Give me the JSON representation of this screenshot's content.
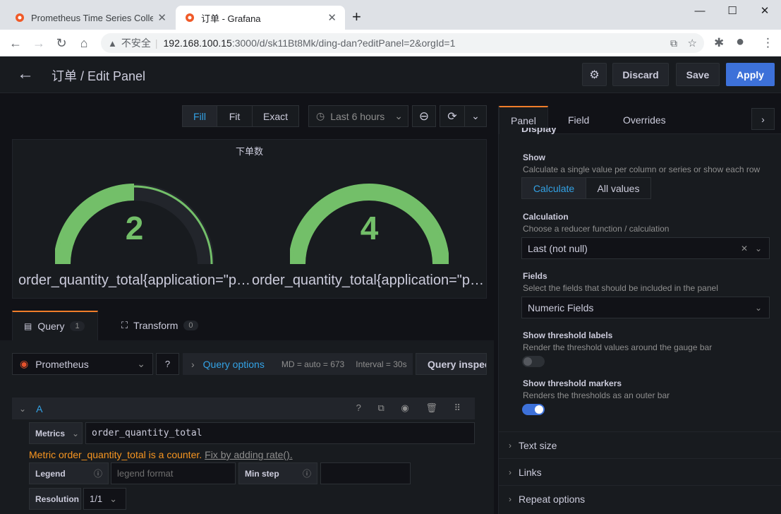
{
  "browser": {
    "tabs": [
      {
        "title": "Prometheus Time Series Collec",
        "active": false
      },
      {
        "title": "订单 - Grafana",
        "active": true
      }
    ],
    "close_glyph": "✕",
    "new_tab_glyph": "+",
    "window_controls": {
      "minimize": "—",
      "maximize": "☐",
      "close": "✕"
    },
    "nav": {
      "back": "←",
      "forward": "→",
      "reload": "↻",
      "home": "⌂"
    },
    "address": {
      "warning_icon": "▲",
      "security_label": "不安全",
      "separator": "|",
      "host": "192.168.100.15",
      "path": ":3000/d/sk11Bt8Mk/ding-dan?editPanel=2&orgId=1",
      "translate_icon": "⧉",
      "star_icon": "☆"
    },
    "extensions": {
      "puzzle": "✱",
      "profile": "●",
      "menu": "⋮"
    }
  },
  "header": {
    "back_glyph": "←",
    "title": "订单 / Edit Panel",
    "settings_glyph": "⚙",
    "discard": "Discard",
    "save": "Save",
    "apply": "Apply"
  },
  "toolbar": {
    "fill": "Fill",
    "fit": "Fit",
    "exact": "Exact",
    "time_range": "Last 6 hours",
    "clock_glyph": "◷",
    "chev_glyph": "⌄",
    "zoom_glyph": "⊖",
    "refresh_glyph": "⟳"
  },
  "panel": {
    "title": "下单数",
    "gauges": [
      {
        "value": "2",
        "fraction": 0.5,
        "label": "order_quantity_total{application=\"p…"
      },
      {
        "value": "4",
        "fraction": 1.0,
        "label": "order_quantity_total{application=\"p…"
      }
    ],
    "colors": {
      "fill": "#73bf69",
      "track": "#22252b"
    }
  },
  "query_tabs": {
    "query": {
      "label": "Query",
      "count": "1",
      "icon": "▤"
    },
    "transform": {
      "label": "Transform",
      "count": "0",
      "icon": "⛶"
    }
  },
  "query_bar": {
    "datasource": "Prometheus",
    "ds_icon": "◉",
    "help_glyph": "?",
    "options_chevron": "›",
    "options_label": "Query options",
    "md": "MD = auto = 673",
    "interval": "Interval = 30s",
    "inspector": "Query inspector"
  },
  "query_a": {
    "name": "A",
    "chevron": "⌄",
    "icons": "? ⧉ ◉ 🗑 ⠿",
    "metrics_label": "Metrics",
    "metrics_value": "order_quantity_total",
    "warning_text": "Metric order_quantity_total is a counter.",
    "warning_link": "Fix by adding rate().",
    "legend_label": "Legend",
    "legend_placeholder": "legend format",
    "minstep_label": "Min step",
    "info_glyph": "ⓘ",
    "resolution_label": "Resolution",
    "resolution_value": "1/1"
  },
  "options_pane": {
    "tabs": {
      "panel": "Panel",
      "field": "Field",
      "overrides": "Overrides"
    },
    "arrow_glyph": "›",
    "section_partial": "Display",
    "show": {
      "title": "Show",
      "desc": "Calculate a single value per column or series or show each row",
      "calculate": "Calculate",
      "all_values": "All values"
    },
    "calculation": {
      "title": "Calculation",
      "desc": "Choose a reducer function / calculation",
      "value": "Last (not null)",
      "clear_glyph": "✕",
      "chev_glyph": "⌄"
    },
    "fields": {
      "title": "Fields",
      "desc": "Select the fields that should be included in the panel",
      "value": "Numeric Fields"
    },
    "threshold_labels": {
      "title": "Show threshold labels",
      "desc": "Render the threshold values around the gauge bar",
      "on": false
    },
    "threshold_markers": {
      "title": "Show threshold markers",
      "desc": "Renders the thresholds as an outer bar",
      "on": true
    },
    "collapsed": [
      "Text size",
      "Links",
      "Repeat options"
    ],
    "collapsed_chevron": "›"
  }
}
